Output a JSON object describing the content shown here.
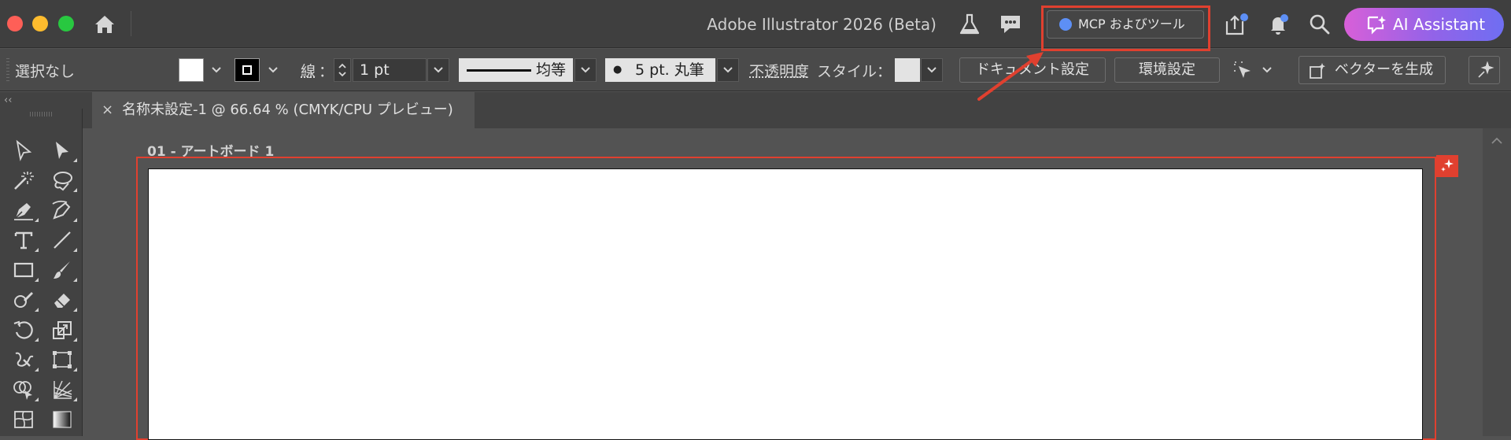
{
  "window": {
    "title": "Adobe Illustrator 2026 (Beta)"
  },
  "titlebar": {
    "mcp_label": "MCP およびツール",
    "ai_assistant_label": "AI Assistant",
    "icons": [
      "home-icon",
      "flask-icon",
      "comment-icon",
      "share-icon",
      "bell-icon",
      "search-icon",
      "ai-assistant-icon"
    ]
  },
  "control_bar": {
    "selection_status": "選択なし",
    "stroke_label": "線",
    "stroke_separator": "：",
    "stroke_weight": "1 pt",
    "stroke_profile": "均等",
    "brush_bullet": "●",
    "brush": "5 pt. 丸筆",
    "opacity_label": "不透明度",
    "style_label": "スタイル：",
    "document_setup": "ドキュメント設定",
    "preferences": "環境設定",
    "generate_vectors": "ベクターを生成"
  },
  "document": {
    "tab_close": "×",
    "tab_title": "名称未設定-1 @ 66.64 % (CMYK/CPU プレビュー)",
    "artboard_label": "01 - アートボード 1"
  },
  "toolbar": {
    "collapse_glyph": "‹‹",
    "tools": [
      "selection-tool-icon",
      "direct-selection-tool-icon",
      "magic-wand-tool-icon",
      "lasso-tool-icon",
      "pen-tool-icon",
      "curvature-tool-icon",
      "type-tool-icon",
      "line-segment-tool-icon",
      "rectangle-tool-icon",
      "paintbrush-tool-icon",
      "shaper-tool-icon",
      "eraser-tool-icon",
      "rotate-tool-icon",
      "scale-tool-icon",
      "warp-tool-icon",
      "free-transform-tool-icon",
      "shape-builder-tool-icon",
      "perspective-grid-tool-icon",
      "mesh-tool-icon",
      "gradient-tool-icon"
    ]
  },
  "colors": {
    "highlight": "#e0402f",
    "mcp_dot": "#5d8ff5",
    "ai_gradient_start": "#d85fd8",
    "ai_gradient_end": "#6f6ef2"
  }
}
